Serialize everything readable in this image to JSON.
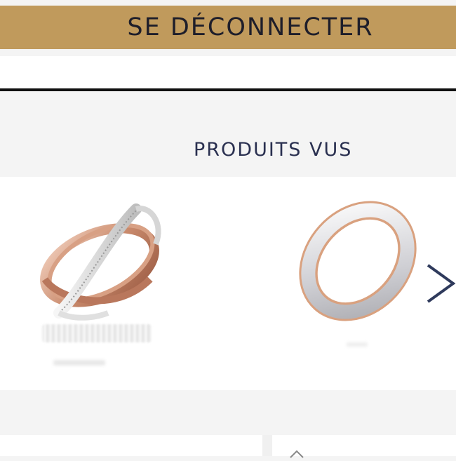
{
  "header": {
    "logout_label": "SE DÉCONNECTER"
  },
  "viewed": {
    "title": "PRODUITS VUS",
    "products": [
      {
        "image": "ring-rose-gold-white-gold-crossover-diamonds",
        "name": ""
      },
      {
        "image": "ring-white-gold-rose-gold-edges",
        "name": ""
      }
    ],
    "next_icon": "chevron-right-icon"
  },
  "colors": {
    "gold": "#c09a5c",
    "title": "#2a3050",
    "arrow": "#2f3a5c"
  }
}
